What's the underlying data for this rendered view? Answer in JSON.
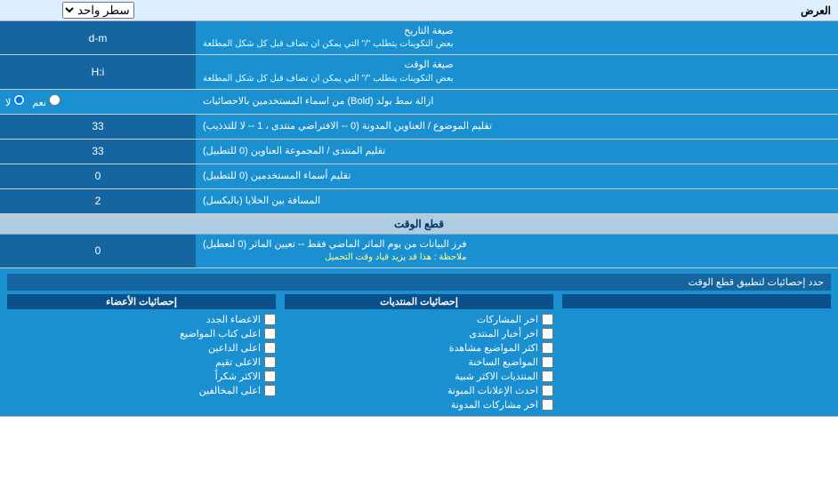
{
  "page": {
    "header": {
      "label": "العرض",
      "select_label": "سطر واحد"
    },
    "rows": [
      {
        "id": "date_format",
        "label": "صيغة التاريخ",
        "sublabel": "بعض التكوينات يتطلب \"/\" التي يمكن ان تضاف قبل كل شكل المطلعة",
        "value": "d-m"
      },
      {
        "id": "time_format",
        "label": "صيغة الوقت",
        "sublabel": "بعض التكوينات يتطلب \"/\" التي يمكن ان تضاف قبل كل شكل المطلعة",
        "value": "H:i"
      },
      {
        "id": "bold_remove",
        "label": "ازالة نمط بولد (Bold) من اسماء المستخدمين بالاحصائيات",
        "type": "radio",
        "options": [
          {
            "label": "نعم",
            "value": "yes"
          },
          {
            "label": "لا",
            "value": "no",
            "checked": true
          }
        ]
      },
      {
        "id": "topic_sort",
        "label": "تقليم الموضوع / العناوين المدونة (0 -- الافتراضي منتدى ، 1 -- لا للتذذيب)",
        "value": "33"
      },
      {
        "id": "forum_sort",
        "label": "تقليم المنتدى / المجموعة العناوين (0 للتطبيل)",
        "value": "33"
      },
      {
        "id": "user_trim",
        "label": "تقليم أسماء المستخدمين (0 للتطبيل)",
        "value": "0"
      },
      {
        "id": "cell_gap",
        "label": "المسافة بين الخلايا (بالبكسل)",
        "value": "2"
      }
    ],
    "cut_section": {
      "header": "قطع الوقت",
      "row": {
        "label": "فرز البيانات من يوم الماثر الماضي فقط -- تعيين الماثر (0 لتعطيل)",
        "note": "ملاحظة : هذا قد يزيد قياد وقت التحميل",
        "value": "0"
      },
      "stats_label": "حدد إحصائيات لتطبيق قطع الوقت"
    },
    "checkboxes": {
      "col1_header": "إحصائيات الأعضاء",
      "col2_header": "إحصائيات المنتديات",
      "col3_header": "",
      "col1_items": [
        {
          "label": "الاعضاء الجدد",
          "checked": false
        },
        {
          "label": "اعلى كتاب المواضيع",
          "checked": false
        },
        {
          "label": "اعلى الداعين",
          "checked": false
        },
        {
          "label": "الاعلى تقيم",
          "checked": false
        },
        {
          "label": "الاكثر شكراً",
          "checked": false
        },
        {
          "label": "اعلى المخالفين",
          "checked": false
        }
      ],
      "col2_items": [
        {
          "label": "اخر المشاركات",
          "checked": false
        },
        {
          "label": "اخر أخبار المنتدى",
          "checked": false
        },
        {
          "label": "اكثر المواضيع مشاهدة",
          "checked": false
        },
        {
          "label": "المواضيع الساخنة",
          "checked": false
        },
        {
          "label": "المنتديات الاكثر شبية",
          "checked": false
        },
        {
          "label": "احدث الإعلانات المبونة",
          "checked": false
        },
        {
          "label": "اخر مشاركات المدونة",
          "checked": false
        }
      ]
    }
  }
}
